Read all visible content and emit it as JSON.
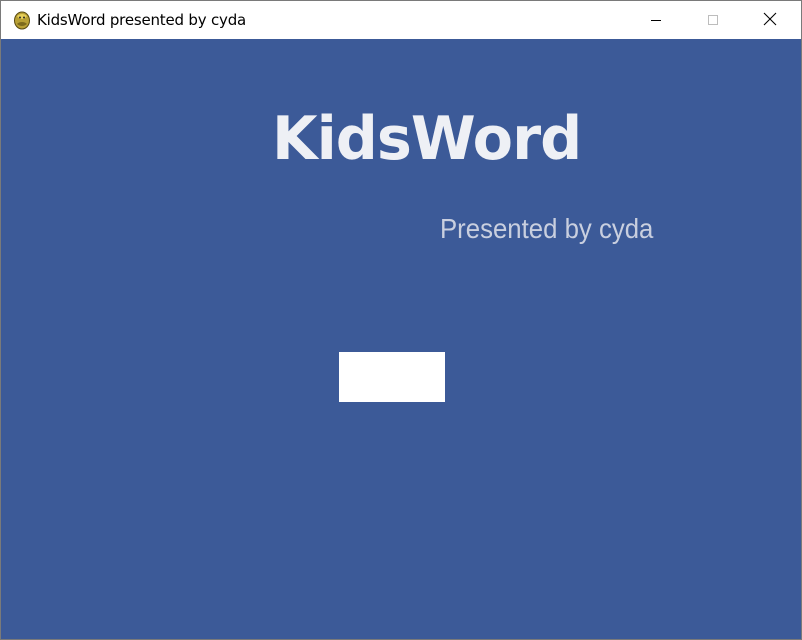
{
  "window": {
    "title": "KidsWord presented by cyda",
    "app_icon": "python-snake-icon",
    "controls": {
      "minimize_icon": "minimize-icon",
      "maximize_icon": "maximize-icon",
      "close_icon": "close-icon"
    }
  },
  "main": {
    "logo_text": "KidsWord",
    "subtitle": "Presented by cyda",
    "white_box_label": ""
  },
  "colors": {
    "background": "#3c5a98",
    "logo_text": "#eef0f5",
    "subtitle_text": "#c9cfdf",
    "box": "#ffffff"
  }
}
